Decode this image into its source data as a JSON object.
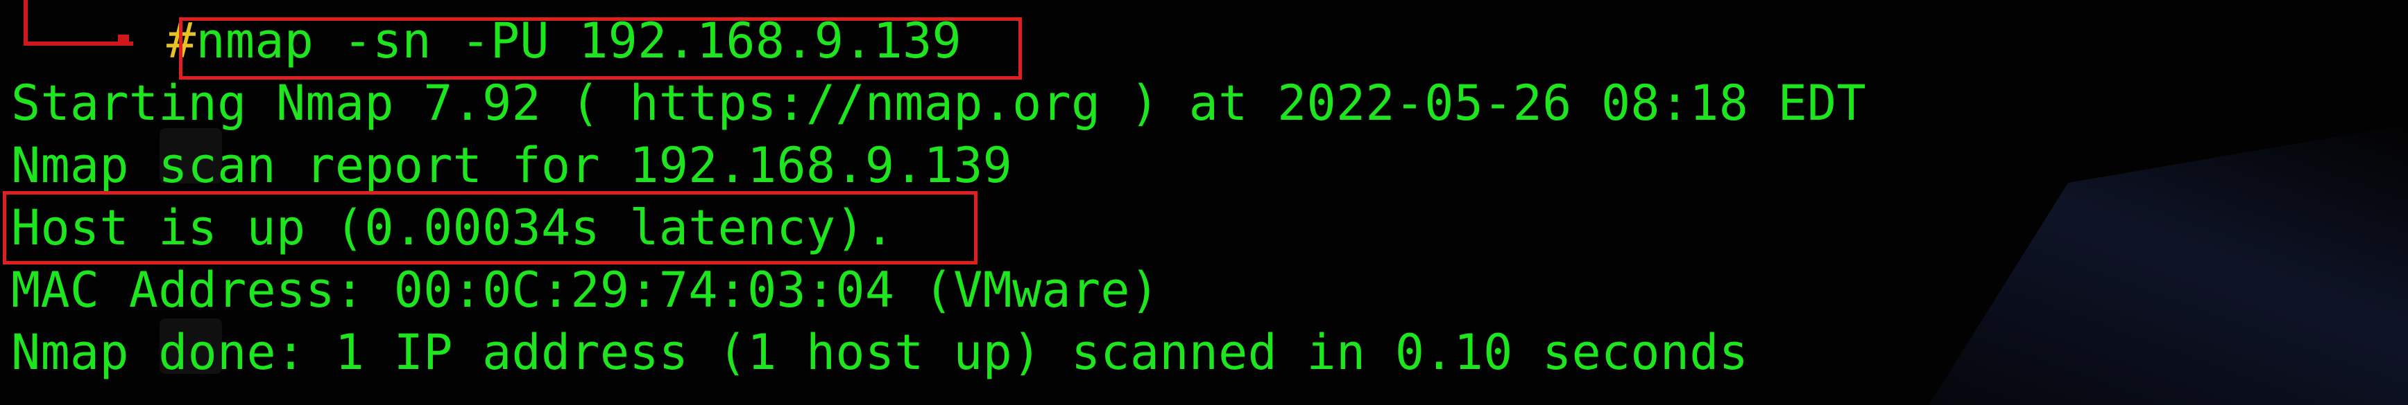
{
  "terminal": {
    "prompt_symbol": "#",
    "command": "nmap -sn -PU 192.168.9.139",
    "output_lines": [
      "Starting Nmap 7.92 ( https://nmap.org ) at 2022-05-26 08:18 EDT",
      "Nmap scan report for 192.168.9.139",
      "Host is up (0.00034s latency).",
      "MAC Address: 00:0C:29:74:03:04 (VMware)",
      "Nmap done: 1 IP address (1 host up) scanned in 0.10 seconds"
    ]
  },
  "colors": {
    "output_text": "#1ee61e",
    "prompt_symbol": "#e6c323",
    "annotation_box": "#e02020",
    "background": "#020202"
  }
}
